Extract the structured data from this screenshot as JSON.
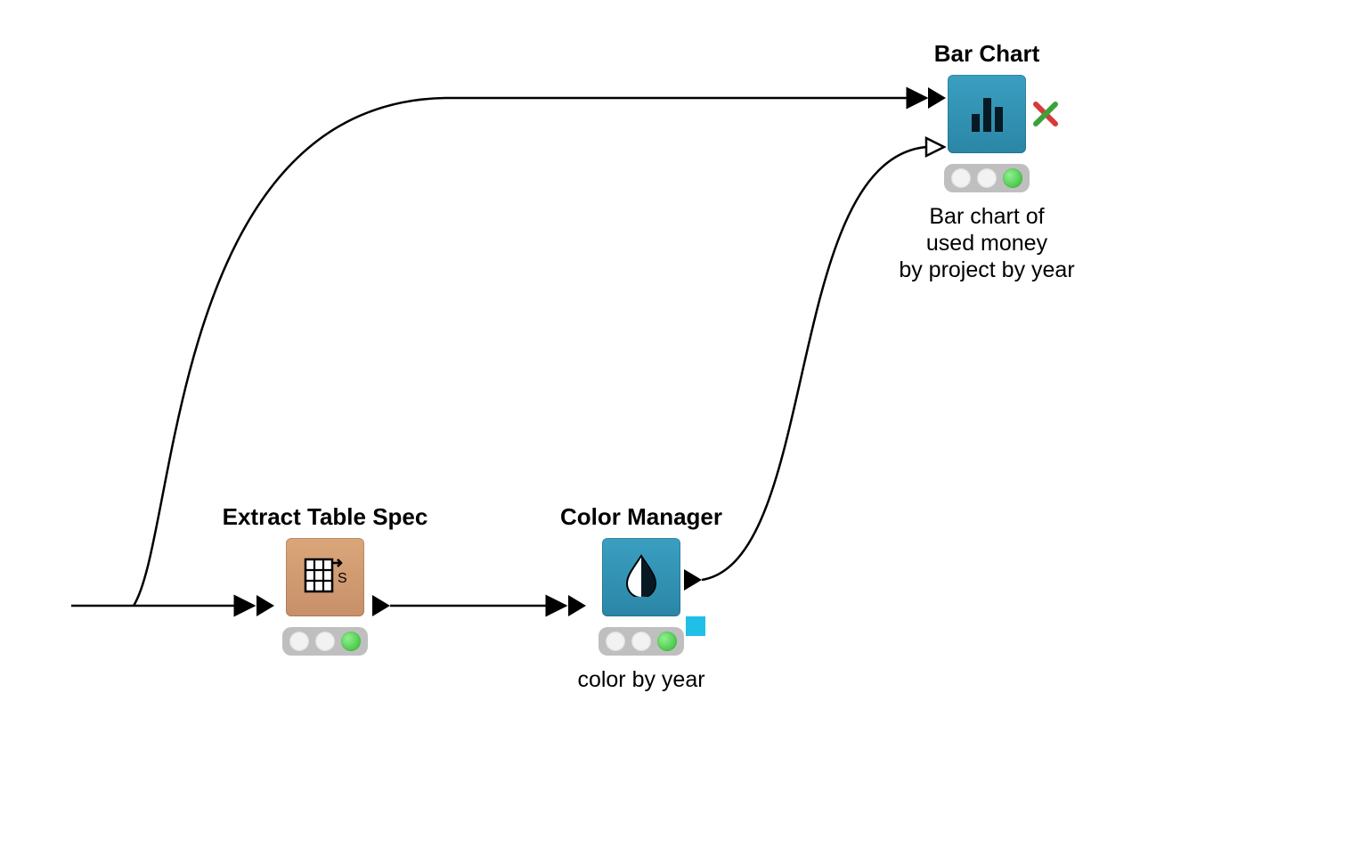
{
  "nodes": {
    "extract_table_spec": {
      "title": "Extract Table Spec",
      "desc": "",
      "status": "green",
      "icon": "table-spec-icon",
      "color": "#d19a6f"
    },
    "color_manager": {
      "title": "Color Manager",
      "desc": "color by year",
      "status": "green",
      "icon": "drop-icon",
      "color": "#2b86a6"
    },
    "bar_chart": {
      "title": "Bar Chart",
      "desc_line1": "Bar chart of",
      "desc_line2": "used money",
      "desc_line3": "by project by year",
      "status": "green",
      "icon": "bar-chart-icon",
      "color": "#2b86a6",
      "error": true
    }
  },
  "colors": {
    "node_blue": "#2b86a6",
    "node_tan": "#d19a6f",
    "status_green": "#2db82d",
    "error_red": "#d73a3a",
    "error_green": "#3aa23a"
  }
}
